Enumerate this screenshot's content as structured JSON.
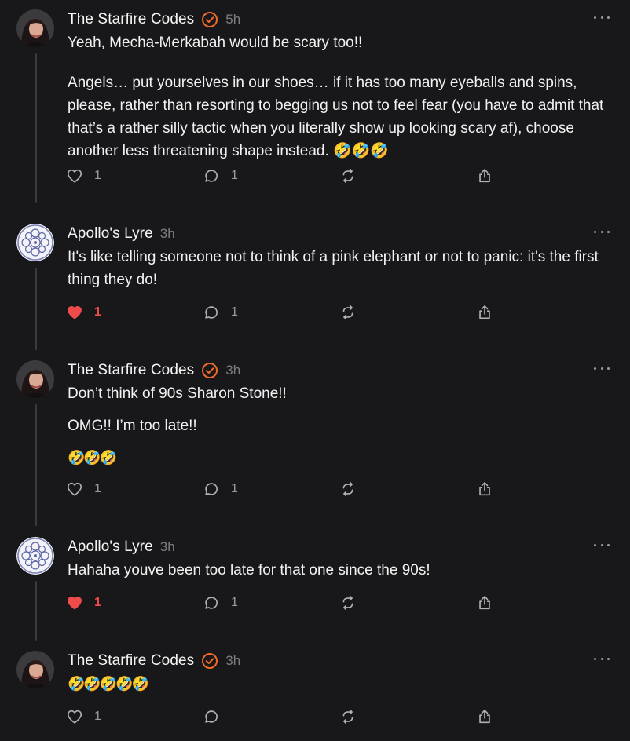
{
  "colors": {
    "background": "#18181a",
    "verified_badge": "#f06a28",
    "liked_heart": "#f04b4b",
    "muted_text": "#7d7d82",
    "thread_line": "#3a3a3d"
  },
  "icons": {
    "like": "heart-outline-icon",
    "liked": "heart-filled-icon",
    "reply": "speech-bubble-icon",
    "repost": "repost-arrows-icon",
    "share": "share-upload-icon",
    "more": "more-ellipsis-icon",
    "verified": "verified-check-badge-icon"
  },
  "posts": [
    {
      "author": "The Starfire Codes",
      "verified": true,
      "time": "5h",
      "paragraphs": [
        "Yeah, Mecha-Merkabah would be scary too!!",
        "Angels… put yourselves in our shoes… if it has too many eyeballs and spins, please, rather than resorting to begging us not to feel fear (you have to admit that that’s a rather silly tactic when you literally show up looking scary af), choose another less threatening shape instead. 🤣🤣🤣"
      ],
      "likes": "1",
      "liked": false,
      "replies": "1"
    },
    {
      "author": "Apollo's Lyre",
      "verified": false,
      "time": "3h",
      "paragraphs": [
        "It's like telling someone not to think of a pink elephant or not to panic: it's the first thing they do!"
      ],
      "likes": "1",
      "liked": true,
      "replies": "1"
    },
    {
      "author": "The Starfire Codes",
      "verified": true,
      "time": "3h",
      "paragraphs": [
        "Don’t think of 90s Sharon Stone!!",
        "OMG!! I’m too late!!",
        "🤣🤣🤣"
      ],
      "likes": "1",
      "liked": false,
      "replies": "1"
    },
    {
      "author": "Apollo's Lyre",
      "verified": false,
      "time": "3h",
      "paragraphs": [
        "Hahaha youve been too late for that one since the 90s!"
      ],
      "likes": "1",
      "liked": true,
      "replies": "1"
    },
    {
      "author": "The Starfire Codes",
      "verified": true,
      "time": "3h",
      "paragraphs": [
        "🤣🤣🤣🤣🤣"
      ],
      "likes": "1",
      "liked": false,
      "replies": ""
    }
  ]
}
